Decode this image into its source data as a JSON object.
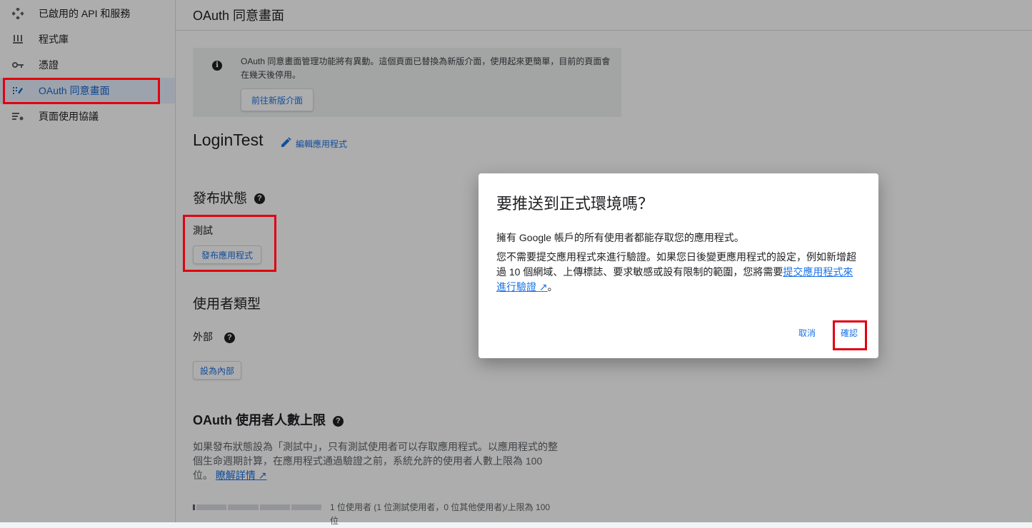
{
  "sidebar": {
    "items": [
      {
        "icon": "api-icon",
        "label": "已啟用的 API 和服務"
      },
      {
        "icon": "library-icon",
        "label": "程式庫"
      },
      {
        "icon": "key-icon",
        "label": "憑證"
      },
      {
        "icon": "oauth-consent-icon",
        "label": "OAuth 同意畫面"
      },
      {
        "icon": "page-usage-agreement-icon",
        "label": "頁面使用協議"
      }
    ],
    "active_index": 3
  },
  "main": {
    "page_title": "OAuth 同意畫面",
    "info": {
      "text": "OAuth 同意畫面管理功能將有異動。這個頁面已替換為新版介面，使用起來更簡單，目前的頁面會在幾天後停用。",
      "button": "前往新版介面"
    },
    "app_name": "LoginTest",
    "edit_label": "編輯應用程式",
    "publish_status": {
      "title": "發布狀態",
      "value": "測試",
      "button": "發布應用程式"
    },
    "user_type": {
      "title": "使用者類型",
      "value": "外部",
      "button": "設為內部"
    },
    "user_limit": {
      "title": "OAuth 使用者人數上限",
      "description": "如果發布狀態設為「測試中」，只有測試使用者可以存取應用程式。以應用程式的整個生命週期計算，在應用程式通過驗證之前，系統允許的使用者人數上限為 100 位。",
      "link": "瞭解詳情",
      "progress_label": "1 位使用者 (1 位測試使用者，0 位其他使用者)/上限為 100 位",
      "progress_fraction": 0.01
    }
  },
  "dialog": {
    "title": "要推送到正式環境嗎？",
    "p1": "擁有 Google 帳戶的所有使用者都能存取您的應用程式。",
    "p2": "您不需要提交應用程式來進行驗證。如果您日後變更應用程式的設定，例如新增超過 10 個網域、上傳標誌、要求敏感或設有限制的範圍，您將需要",
    "p2_link": "提交應用程式來進行驗證",
    "p2_end": "。",
    "cancel": "取消",
    "confirm": "確認"
  },
  "colors": {
    "accent": "#1a73e8",
    "highlight": "#e0000f"
  }
}
